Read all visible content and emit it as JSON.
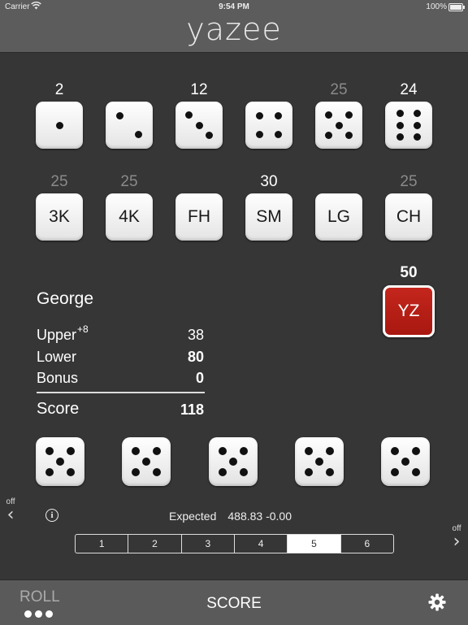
{
  "status_bar": {
    "carrier": "Carrier",
    "time": "9:54 PM",
    "battery": "100%"
  },
  "app_title": "yazee",
  "upper_categories": [
    {
      "score": "2",
      "pips": 1,
      "dim": false
    },
    {
      "score": "",
      "pips": 2,
      "dim": false
    },
    {
      "score": "12",
      "pips": 3,
      "dim": false
    },
    {
      "score": "",
      "pips": 4,
      "dim": false
    },
    {
      "score": "25",
      "pips": 5,
      "dim": true
    },
    {
      "score": "24",
      "pips": 6,
      "dim": false
    }
  ],
  "lower_categories": [
    {
      "label": "3K",
      "score": "25",
      "dim": true
    },
    {
      "label": "4K",
      "score": "25",
      "dim": true
    },
    {
      "label": "FH",
      "score": "",
      "dim": false
    },
    {
      "label": "SM",
      "score": "30",
      "dim": false
    },
    {
      "label": "LG",
      "score": "",
      "dim": false
    },
    {
      "label": "CH",
      "score": "25",
      "dim": true
    }
  ],
  "yahtzee": {
    "label": "YZ",
    "score": "50"
  },
  "scorecard": {
    "player": "George",
    "upper_label": "Upper",
    "upper_bonus_hint": "+8",
    "upper_value": "38",
    "lower_label": "Lower",
    "lower_value": "80",
    "bonus_label": "Bonus",
    "bonus_value": "0",
    "score_label": "Score",
    "score_value": "118"
  },
  "rolled_dice": [
    5,
    5,
    5,
    5,
    5
  ],
  "nav": {
    "left_label": "off",
    "right_label": "off"
  },
  "expected": {
    "label": "Expected",
    "value": "488.83 -0.00"
  },
  "segments": {
    "items": [
      "1",
      "2",
      "3",
      "4",
      "5",
      "6"
    ],
    "selected": 4
  },
  "bottom_bar": {
    "roll": "ROLL",
    "score": "SCORE"
  },
  "icons": {
    "left": "chevron-left-icon",
    "right": "chevron-right-icon",
    "info": "info-icon",
    "settings": "gear-icon",
    "wifi": "wifi-icon",
    "battery": "battery-icon"
  },
  "colors": {
    "background": "#363636",
    "header": "#5c5c5c",
    "yahtzee": "#b81e14"
  }
}
